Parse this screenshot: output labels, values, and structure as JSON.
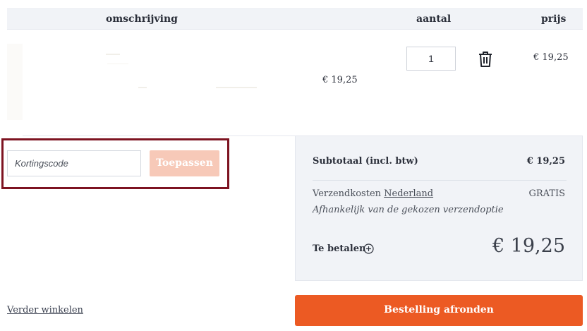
{
  "table_header": {
    "description": "omschrijving",
    "quantity": "aantal",
    "price": "prijs"
  },
  "cart_item": {
    "unit_price": "€ 19,25",
    "quantity": "1",
    "line_price": "€ 19,25",
    "remove_icon": "trash-icon"
  },
  "discount": {
    "placeholder": "Kortingscode",
    "apply_label": "Toepassen",
    "highlight_color": "#7d1321"
  },
  "summary": {
    "subtotal_label": "Subtotaal (incl. btw)",
    "subtotal_value": "€ 19,25",
    "shipping_label": "Verzendkosten",
    "shipping_country": "Nederland",
    "shipping_value": "GRATIS",
    "shipping_note": "Afhankelijk van de gekozen verzendoptie",
    "total_label": "Te betalen",
    "total_value": "€ 19,25",
    "info_icon": "plus-circle-icon"
  },
  "actions": {
    "continue_label": "Verder winkelen",
    "checkout_label": "Bestelling afronden",
    "checkout_color": "#ec5a23"
  }
}
